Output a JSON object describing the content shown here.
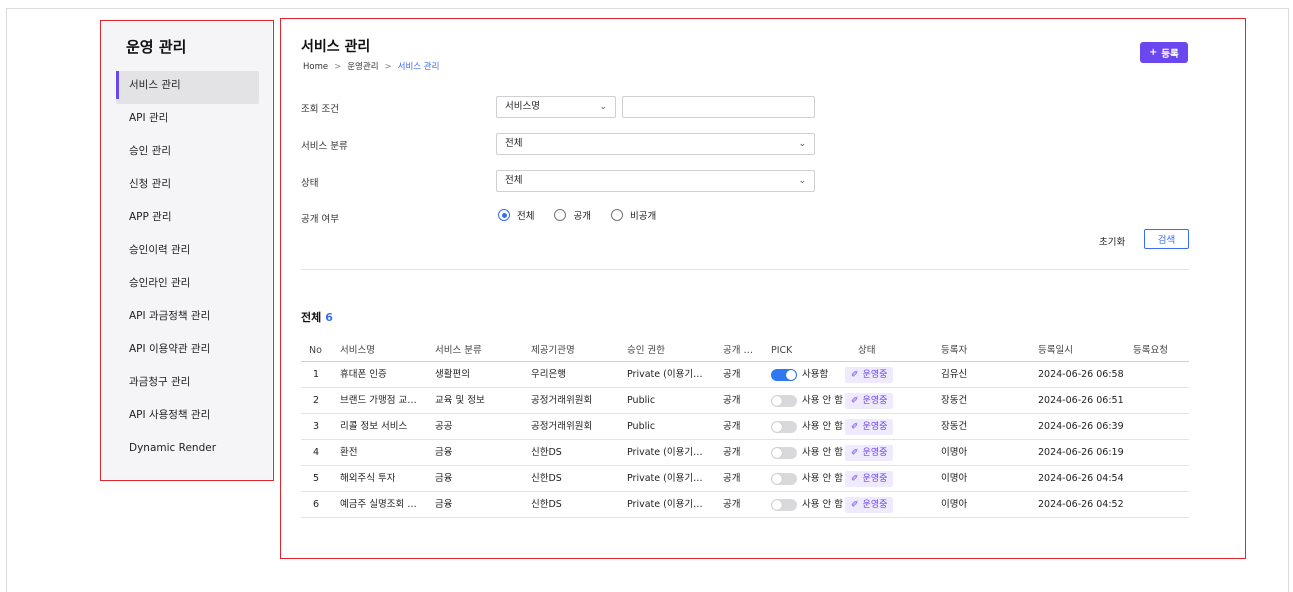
{
  "sidebar": {
    "title": "운영 관리",
    "items": [
      {
        "label": "서비스 관리"
      },
      {
        "label": "API 관리"
      },
      {
        "label": "승인 관리"
      },
      {
        "label": "신청 관리"
      },
      {
        "label": "APP 관리"
      },
      {
        "label": "승인이력 관리"
      },
      {
        "label": "승인라인 관리"
      },
      {
        "label": "API 과금정책 관리"
      },
      {
        "label": "API 이용약관 관리"
      },
      {
        "label": "과금청구 관리"
      },
      {
        "label": "API 사용정책 관리"
      },
      {
        "label": "Dynamic Render"
      }
    ],
    "active_index": 0
  },
  "header": {
    "title": "서비스 관리",
    "breadcrumb": [
      "Home",
      "운영관리",
      "서비스 관리"
    ],
    "register_label": "등록"
  },
  "filters": {
    "search_label": "조회 조건",
    "search_select": "서비스명",
    "search_value": "",
    "category_label": "서비스 분류",
    "category_value": "전체",
    "status_label": "상태",
    "status_value": "전체",
    "public_label": "공개 여부",
    "public_options": [
      "전체",
      "공개",
      "비공개"
    ],
    "public_selected": 0,
    "reset_label": "초기화",
    "search_button": "검색"
  },
  "summary": {
    "label": "전체",
    "count": "6"
  },
  "table": {
    "columns": [
      "No",
      "서비스명",
      "서비스 분류",
      "제공기관명",
      "승인 권한",
      "공개 …",
      "PICK",
      "상태",
      "등록자",
      "등록일시",
      "등록요청"
    ],
    "rows": [
      {
        "no": "1",
        "name": "휴대폰 인증",
        "category": "생활편의",
        "provider": "우리은행",
        "auth": "Private (이용기…",
        "public": "공개",
        "pick_on": true,
        "pick_label": "사용함",
        "status": "운영중",
        "registrant": "김유신",
        "date": "2024-06-26 06:58",
        "request": ""
      },
      {
        "no": "2",
        "name": "브랜드 가맹점 교…",
        "category": "교육 및 정보",
        "provider": "공정거래위원회",
        "auth": "Public",
        "public": "공개",
        "pick_on": false,
        "pick_label": "사용 안 함",
        "status": "운영중",
        "registrant": "장동건",
        "date": "2024-06-26 06:51",
        "request": ""
      },
      {
        "no": "3",
        "name": "리콜 정보 서비스",
        "category": "공공",
        "provider": "공정거래위원회",
        "auth": "Public",
        "public": "공개",
        "pick_on": false,
        "pick_label": "사용 안 함",
        "status": "운영중",
        "registrant": "장동건",
        "date": "2024-06-26 06:39",
        "request": ""
      },
      {
        "no": "4",
        "name": "환전",
        "category": "금융",
        "provider": "신한DS",
        "auth": "Private (이용기…",
        "public": "공개",
        "pick_on": false,
        "pick_label": "사용 안 함",
        "status": "운영중",
        "registrant": "이명아",
        "date": "2024-06-26 06:19",
        "request": ""
      },
      {
        "no": "5",
        "name": "해외주식 투자",
        "category": "금융",
        "provider": "신한DS",
        "auth": "Private (이용기…",
        "public": "공개",
        "pick_on": false,
        "pick_label": "사용 안 함",
        "status": "운영중",
        "registrant": "이명아",
        "date": "2024-06-26 04:54",
        "request": ""
      },
      {
        "no": "6",
        "name": "예금주 실명조회 …",
        "category": "금융",
        "provider": "신한DS",
        "auth": "Private (이용기…",
        "public": "공개",
        "pick_on": false,
        "pick_label": "사용 안 함",
        "status": "운영중",
        "registrant": "이명아",
        "date": "2024-06-26 04:52",
        "request": ""
      }
    ]
  },
  "colors": {
    "accent": "#6b47f0",
    "link": "#3a6df0",
    "toggle_on": "#2f78f2",
    "highlight": "#e0242b"
  }
}
